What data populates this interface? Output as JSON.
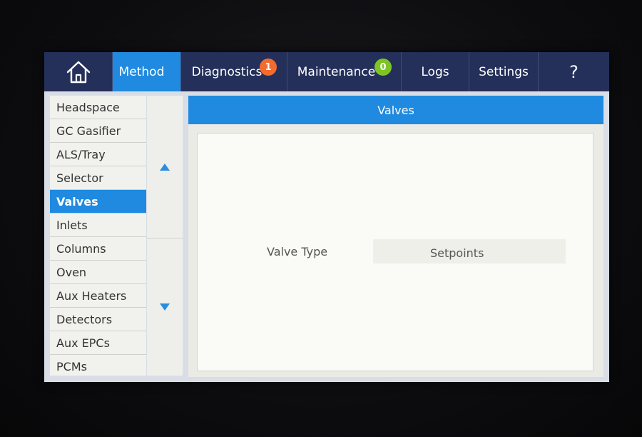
{
  "nav": {
    "tabs": [
      {
        "label": "Method"
      },
      {
        "label": "Diagnostics",
        "badge": "1"
      },
      {
        "label": "Maintenance",
        "badge": "0"
      },
      {
        "label": "Logs"
      },
      {
        "label": "Settings"
      },
      {
        "label": "?"
      }
    ]
  },
  "sidebar": {
    "items": [
      {
        "label": "Headspace"
      },
      {
        "label": "GC Gasifier"
      },
      {
        "label": "ALS/Tray"
      },
      {
        "label": "Selector"
      },
      {
        "label": "Valves"
      },
      {
        "label": "Inlets"
      },
      {
        "label": "Columns"
      },
      {
        "label": "Oven"
      },
      {
        "label": "Aux Heaters"
      },
      {
        "label": "Detectors"
      },
      {
        "label": "Aux EPCs"
      },
      {
        "label": "PCMs"
      }
    ],
    "selected": "Valves"
  },
  "panel": {
    "title": "Valves",
    "columns": [
      "Valve Type",
      "Setpoints"
    ]
  },
  "colors": {
    "accent": "#1f8ae0",
    "nav_background": "#24305a",
    "badge_alert": "#f26b2f",
    "badge_ok": "#7cc525"
  },
  "icons": {
    "home": "home-icon",
    "scroll_up": "triangle-up-icon",
    "scroll_down": "triangle-down-icon"
  }
}
